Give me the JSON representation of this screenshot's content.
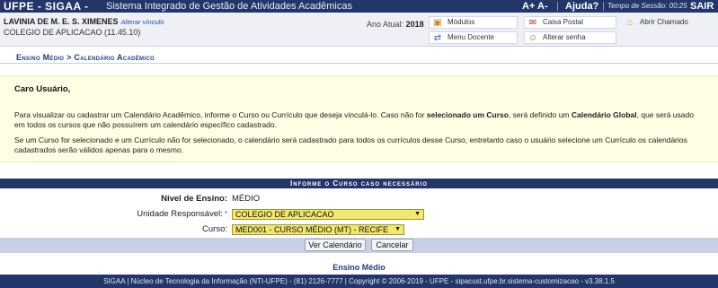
{
  "topbar": {
    "system": "UFPE - SIGAA -",
    "system_name": "Sistema Integrado de Gestão de Atividades Acadêmicas",
    "font_controls": "A+ A-",
    "help": "Ajuda?",
    "session": "Tempo de Sessão: 00:25",
    "logout": "SAIR"
  },
  "user": {
    "name": "LAVINIA DE M. E. S. XIMENES",
    "change_link": "Alterar vínculo",
    "org": "COLEGIO DE APLICACAO (11.45.10)",
    "year_label": "Ano Atual:",
    "year_value": "2018"
  },
  "quick_links": {
    "modules": "Módulos",
    "mailbox": "Caixa Postal",
    "open_ticket": "Abrir Chamado",
    "teacher_menu": "Menu Docente",
    "change_password": "Alterar senha"
  },
  "breadcrumb": "Ensino Médio > Calendário Acadêmico",
  "message": {
    "greeting": "Caro Usuário,",
    "p1_a": "Para visualizar ou cadastrar um Calendário Acadêmico, informe o Curso ou Currículo que deseja vinculá-lo. Caso não for ",
    "p1_b": "selecionado um Curso",
    "p1_c": ", será definido um ",
    "p1_d": "Calendário Global",
    "p1_e": ", que será usado em todos os cursos que não possuírem um calendário específico cadastrado.",
    "p2": "Se um Curso for selecionado e um Currículo não for selecionado, o calendário será cadastrado para todos os currículos desse Curso, entretanto caso o usuário selecione um Currículo os calendários cadastrados serão válidos apenas para o mesmo."
  },
  "form": {
    "header": "Informe o Curso caso necessário",
    "level_label": "Nível de Ensino:",
    "level_value": "MÉDIO",
    "unit_label": "Unidade Responsável:",
    "unit_required": "*",
    "unit_value": "COLEGIO DE APLICACAO",
    "course_label": "Curso:",
    "course_value": "MED001 - CURSO MÉDIO (MT) - RECIFE",
    "view_button": "Ver Calendário",
    "cancel_button": "Cancelar"
  },
  "level_link": "Ensino Médio",
  "footer": "SIGAA | Núcleo de Tecnologia da Informação (NTI-UFPE) - (81) 2126-7777 | Copyright © 2006-2019 - UFPE - sipacust.ufpe.br.sistema-customizacao - v3.38.1.5",
  "colors": {
    "header_bg": "#23366a",
    "message_bg": "#fffde3",
    "select_bg": "#f2e86a",
    "link": "#1f3c84"
  }
}
